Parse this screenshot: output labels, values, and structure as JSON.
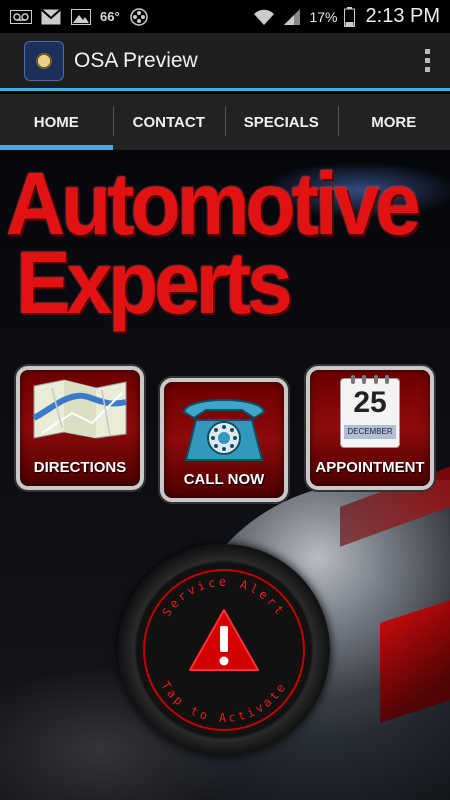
{
  "status_bar": {
    "temperature": "66°",
    "battery": "17%",
    "time": "2:13 PM"
  },
  "action_bar": {
    "title": "OSA Preview"
  },
  "tabs": [
    {
      "label": "HOME",
      "active": true
    },
    {
      "label": "CONTACT",
      "active": false
    },
    {
      "label": "SPECIALS",
      "active": false
    },
    {
      "label": "MORE",
      "active": false
    }
  ],
  "hero": {
    "headline_line1": "Automotive",
    "headline_line2": "Experts"
  },
  "tiles": {
    "directions": {
      "label": "DIRECTIONS"
    },
    "call_now": {
      "label": "CALL NOW"
    },
    "appointment": {
      "label": "APPOINTMENT",
      "calendar_day": "25",
      "calendar_month": "DECEMBER"
    }
  },
  "service_alert": {
    "top_text": "Service Alert",
    "bottom_text": "Tap to Activate",
    "icon": "warning-icon"
  },
  "colors": {
    "accent": "#33b5e5",
    "brand_red": "#e31212"
  }
}
